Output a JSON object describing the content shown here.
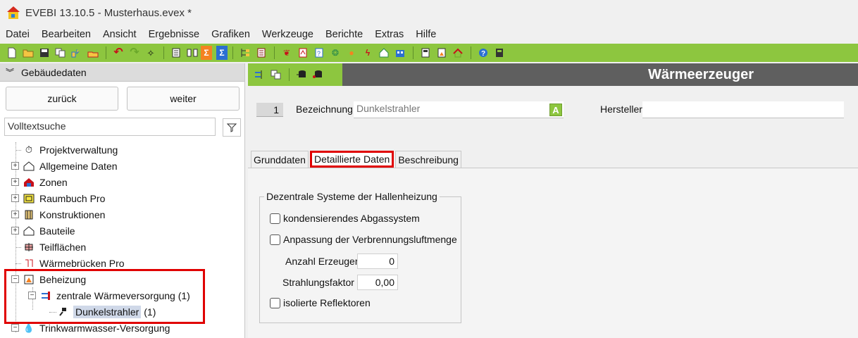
{
  "window": {
    "title": "EVEBI 13.10.5 - Musterhaus.evex *"
  },
  "menu": [
    "Datei",
    "Bearbeiten",
    "Ansicht",
    "Ergebnisse",
    "Grafiken",
    "Werkzeuge",
    "Berichte",
    "Extras",
    "Hilfe"
  ],
  "toolbar_icons": [
    "new-file-icon",
    "open-folder-icon",
    "save-icon",
    "copy-icon",
    "import-icon",
    "export-icon",
    "undo-icon",
    "redo-icon",
    "wand-icon",
    "document-icon",
    "split-icon",
    "sum-icon",
    "sigma-icon",
    "tree-icon",
    "list-icon",
    "bird-icon",
    "pdf-icon",
    "help-doc-icon",
    "network-icon",
    "sun-icon",
    "lightning-icon",
    "house-check-icon",
    "building-icon",
    "report-icon",
    "chart-icon",
    "roof-icon",
    "question-icon",
    "calculator-icon"
  ],
  "left": {
    "header": "Gebäudedaten",
    "back_label": "zurück",
    "next_label": "weiter",
    "search_placeholder": "Volltextsuche",
    "tree": [
      "Projektverwaltung",
      "Allgemeine Daten",
      "Zonen",
      "Raumbuch Pro",
      "Konstruktionen",
      "Bauteile",
      "Teilflächen",
      "Wärmebrücken Pro",
      "Beheizung",
      "zentrale Wärmeversorgung (1)",
      "Dunkelstrahler",
      "(1)",
      "Trinkwarmwasser-Versorgung"
    ]
  },
  "right": {
    "title": "Wärmeerzeuger",
    "index": "1",
    "bezeichnung_label": "Bezeichnung",
    "bezeichnung_value": "Dunkelstrahler",
    "a_label": "A",
    "hersteller_label": "Hersteller",
    "hersteller_value": "",
    "tabs": [
      "Grunddaten",
      "Detaillierte Daten",
      "Beschreibung"
    ],
    "group_title": "Dezentrale Systeme der Hallenheizung",
    "cb_kondens": "kondensierendes Abgassystem",
    "cb_anpassung": "Anpassung der Verbrennungsluftmenge",
    "anzahl_label": "Anzahl Erzeuger",
    "anzahl_value": "0",
    "strahlung_label": "Strahlungsfaktor",
    "strahlung_value": "0,00",
    "cb_reflektoren": "isolierte Reflektoren"
  },
  "colors": {
    "accent_green": "#8dc63f",
    "header_gray": "#5f5f5f",
    "highlight_red": "#e00000"
  }
}
